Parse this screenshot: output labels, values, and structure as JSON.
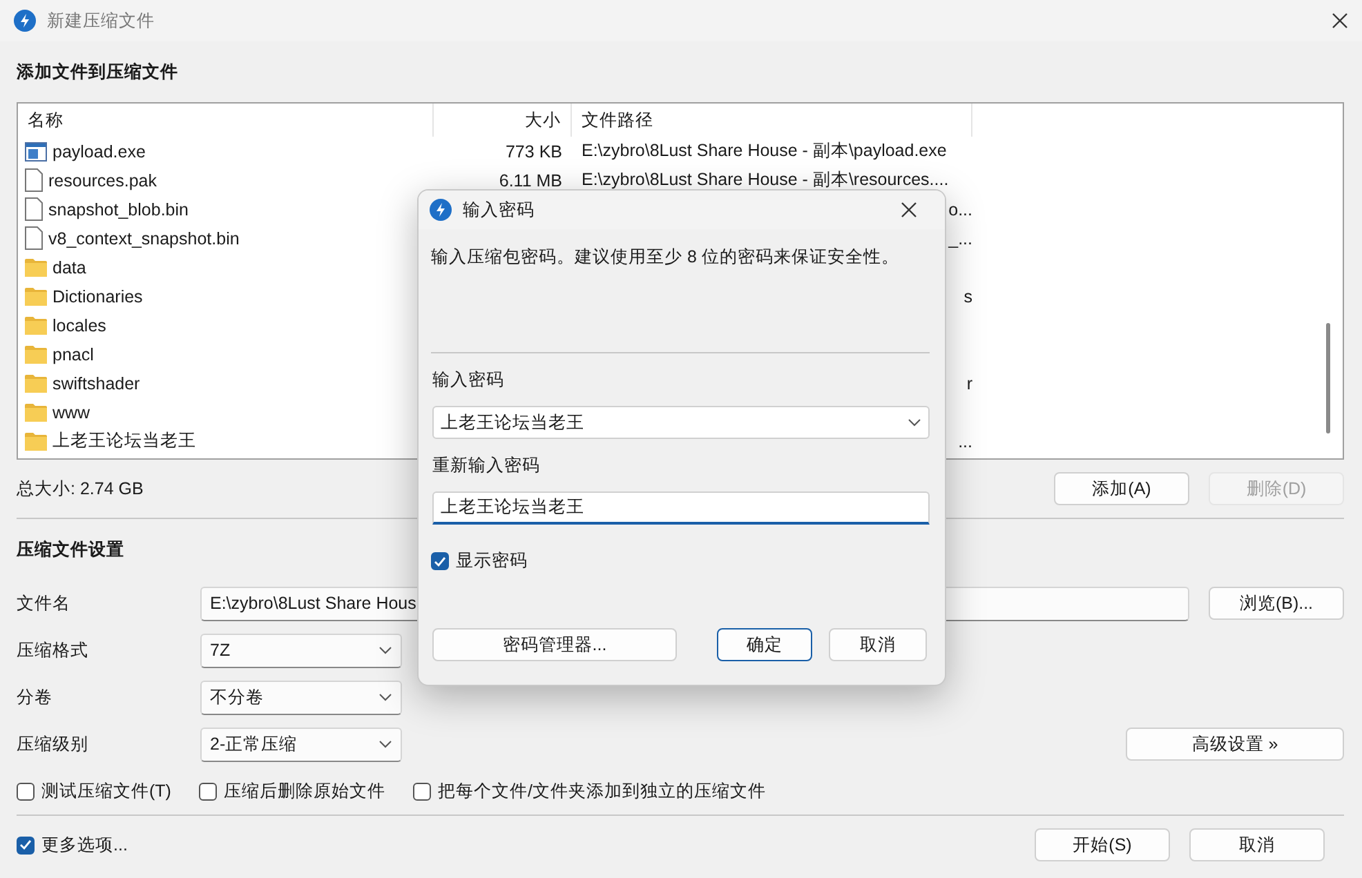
{
  "window": {
    "title": "新建压缩文件"
  },
  "section_heading": "添加文件到压缩文件",
  "file_list": {
    "columns": [
      "名称",
      "大小",
      "文件路径"
    ],
    "rows": [
      {
        "kind": "exe",
        "name": "payload.exe",
        "size": "773 KB",
        "path": "E:\\zybro\\8Lust Share House - 副本\\payload.exe"
      },
      {
        "kind": "file",
        "name": "resources.pak",
        "size": "6.11 MB",
        "path": "E:\\zybro\\8Lust Share House - 副本\\resources...."
      },
      {
        "kind": "file",
        "name": "snapshot_blob.bin",
        "path": "o..."
      },
      {
        "kind": "file",
        "name": "v8_context_snapshot.bin",
        "path": "_..."
      },
      {
        "kind": "folder",
        "name": "data"
      },
      {
        "kind": "folder",
        "name": "Dictionaries",
        "path": "s"
      },
      {
        "kind": "folder",
        "name": "locales"
      },
      {
        "kind": "folder",
        "name": "pnacl"
      },
      {
        "kind": "folder",
        "name": "swiftshader",
        "path": "r"
      },
      {
        "kind": "folder",
        "name": "www"
      },
      {
        "kind": "folder",
        "name": "上老王论坛当老王",
        "path": "..."
      }
    ]
  },
  "total_size": "总大小: 2.74 GB",
  "list_buttons": [
    {
      "label": "添加(A)",
      "disabled": false
    },
    {
      "label": "删除(D)",
      "disabled": true
    }
  ],
  "settings": {
    "heading": "压缩文件设置",
    "filename": {
      "label": "文件名",
      "value": "E:\\zybro\\8Lust Share Hous"
    },
    "browse_button": "浏览(B)...",
    "format": {
      "label": "压缩格式",
      "value": "7Z"
    },
    "volume": {
      "label": "分卷",
      "value": "不分卷"
    },
    "level": {
      "label": "压缩级别",
      "value": "2-正常压缩"
    },
    "advanced_button": "高级设置 »",
    "options": [
      {
        "label": "测试压缩文件(T)",
        "checked": false
      },
      {
        "label": "压缩后删除原始文件",
        "checked": false
      },
      {
        "label": "把每个文件/文件夹添加到独立的压缩文件",
        "checked": false
      }
    ]
  },
  "more_options": {
    "label": "更多选项...",
    "checked": true
  },
  "footer_buttons": [
    {
      "label": "开始(S)",
      "default": false
    },
    {
      "label": "取消",
      "default": false
    }
  ],
  "dialog": {
    "title": "输入密码",
    "message": "输入压缩包密码。建议使用至少 8 位的密码来保证安全性。",
    "password_label": "输入密码",
    "password": "上老王论坛当老王",
    "confirm_label": "重新输入密码",
    "confirm": "上老王论坛当老王",
    "show_password": {
      "label": "显示密码",
      "checked": true
    },
    "manager_button": "密码管理器...",
    "buttons": [
      {
        "label": "确定",
        "default": true
      },
      {
        "label": "取消",
        "default": false
      }
    ]
  }
}
